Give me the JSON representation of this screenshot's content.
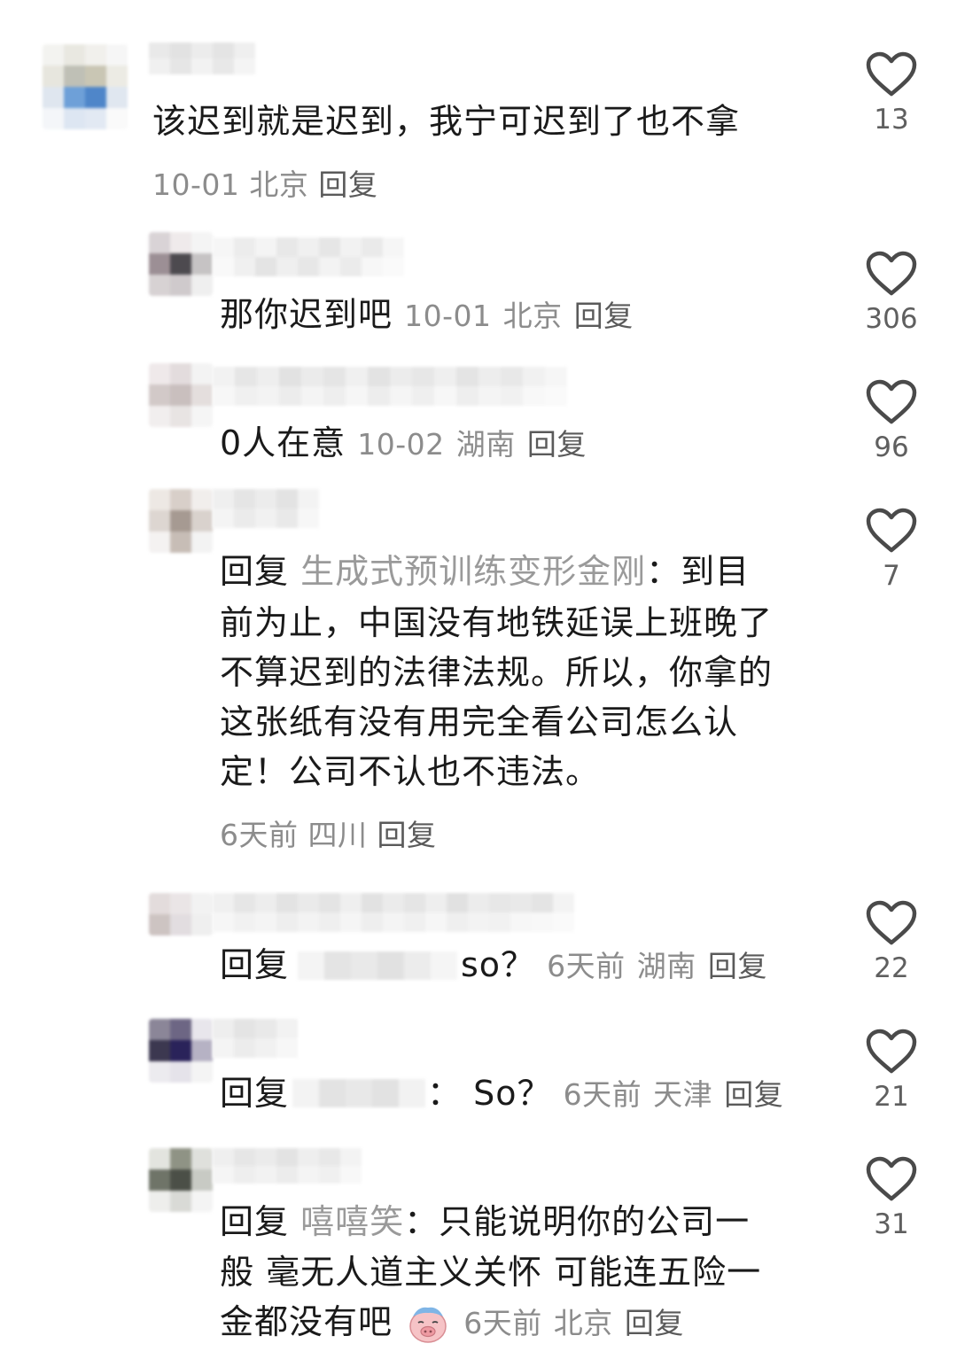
{
  "comments": [
    {
      "text": "该迟到就是迟到，我宁可迟到了也不拿",
      "date": "10-01",
      "location": "北京",
      "reply_label": "回复",
      "likes": "13"
    },
    {
      "text": "那你迟到吧",
      "date": "10-01",
      "location": "北京",
      "reply_label": "回复",
      "likes": "306"
    },
    {
      "text": "0人在意",
      "date": "10-02",
      "location": "湖南",
      "reply_label": "回复",
      "likes": "96"
    },
    {
      "prefix": "回复",
      "mention": "生成式预训练变形金刚",
      "colon": "：",
      "lines": [
        "到目",
        "前为止，中国没有地铁延误上班晚了",
        "不算迟到的法律法规。所以，你拿的",
        "这张纸有没有用完全看公司怎么认",
        "定！公司不认也不违法。"
      ],
      "date": "6天前",
      "location": "四川",
      "reply_label": "回复",
      "likes": "7"
    },
    {
      "prefix": "回复",
      "text": "so？",
      "date": "6天前",
      "location": "湖南",
      "reply_label": "回复",
      "likes": "22"
    },
    {
      "prefix": "回复",
      "colon": "：",
      "text": "So？",
      "date": "6天前",
      "location": "天津",
      "reply_label": "回复",
      "likes": "21"
    },
    {
      "prefix": "回复",
      "mention": "嘻嘻笑",
      "colon": "：",
      "lines": [
        "只能说明你的公司一",
        "般 毫无人道主义关怀 可能连五险一",
        "金都没有吧"
      ],
      "emoji": "sleepy-pig-emoji",
      "date": "6天前",
      "location": "北京",
      "reply_label": "回复",
      "likes": "31"
    }
  ],
  "icons": {
    "like": "heart-outline-icon"
  },
  "colors": {
    "text": "#1a1a1a",
    "meta": "#8c8c8c",
    "mention": "#9a9a9a",
    "like_stroke": "#4a4a4a"
  }
}
